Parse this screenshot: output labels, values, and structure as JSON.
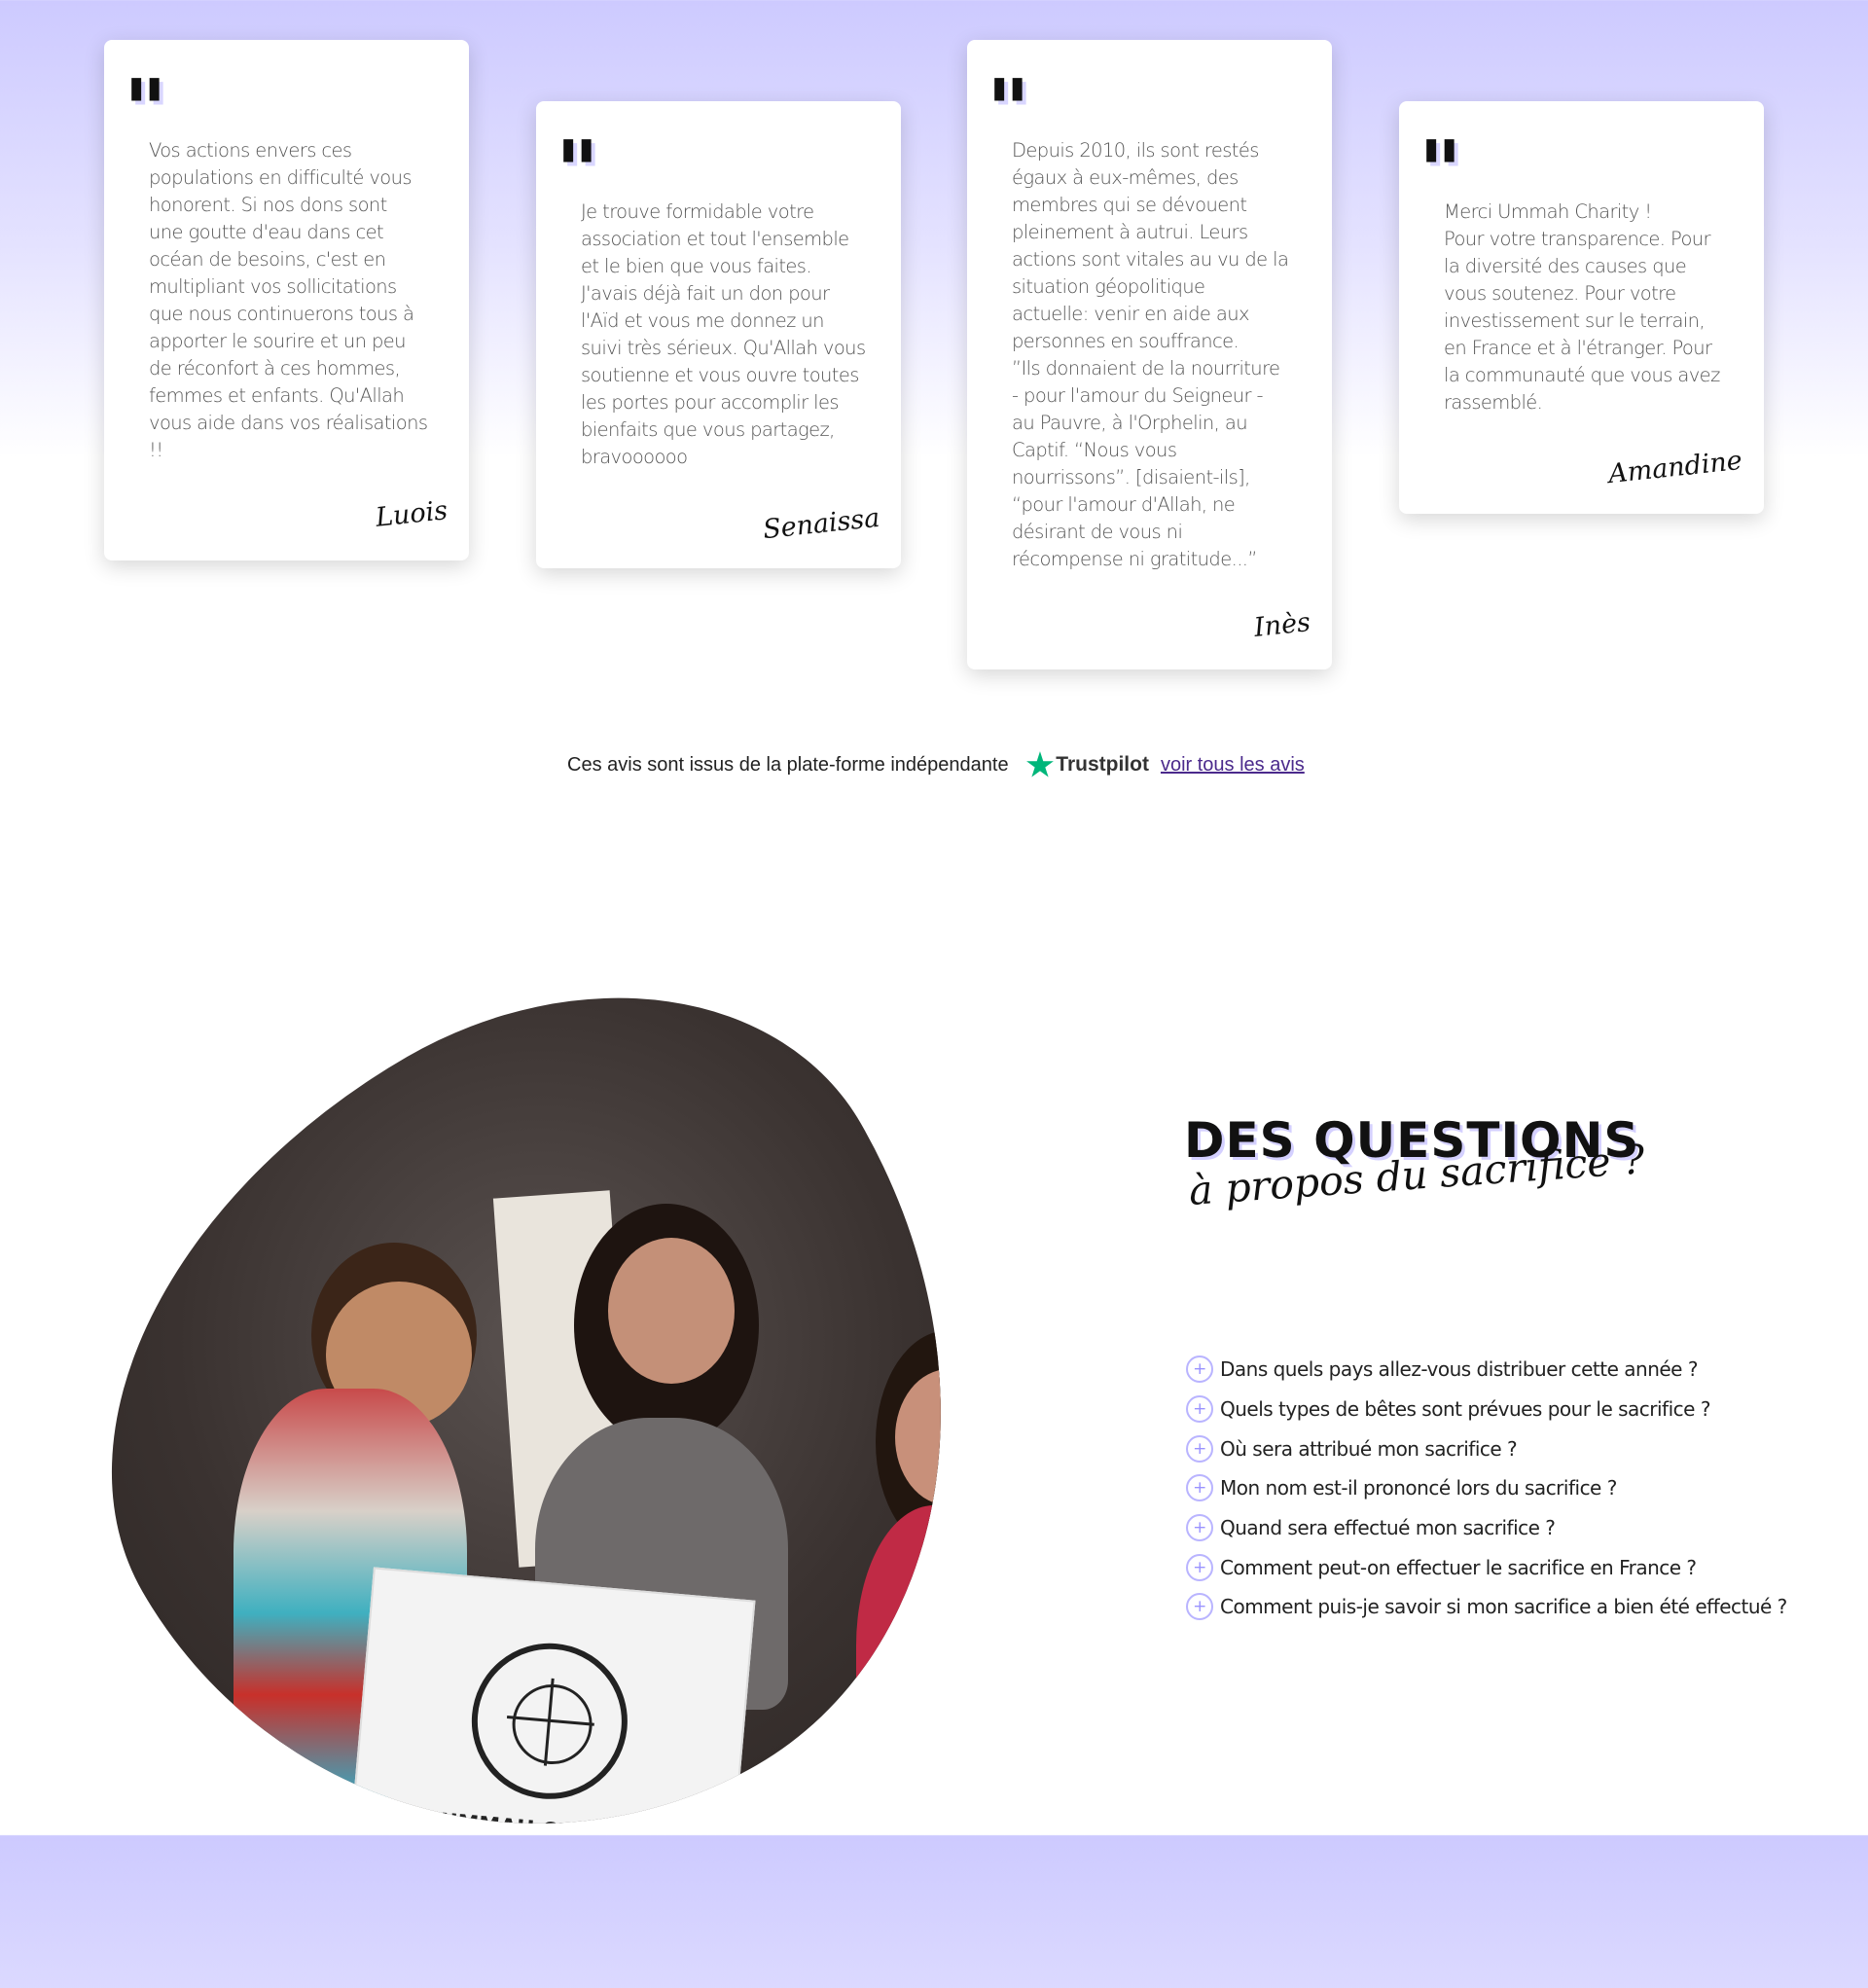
{
  "testimonials": [
    {
      "text": "Vos actions envers ces\npopulations en difficulté vous\nhonorent. Si nos dons sont\nune goutte d'eau dans cet\nocéan de besoins, c'est en\nmultipliant vos sollicitations\nque nous continuerons tous à\napporter le sourire et un peu\nde réconfort à ces hommes,\nfemmes et enfants. Qu'Allah\nvous aide dans vos réalisations\n!!",
      "author": "Luois"
    },
    {
      "text": "Je trouve formidable votre\nassociation et tout l'ensemble\net le bien que vous faites.\nJ'avais déjà fait un don pour\nl'Aïd et vous me donnez un\nsuivi très sérieux. Qu'Allah vous\nsoutienne et vous ouvre toutes\nles portes pour accomplir les\nbienfaits que vous partagez,\nbravoooooo",
      "author": "Senaissa"
    },
    {
      "text": "Depuis 2010, ils sont restés\négaux à eux-mêmes, des\nmembres qui se dévouent\npleinement à autrui. Leurs\nactions sont vitales au vu de la\nsituation géopolitique\nactuelle: venir en aide aux\npersonnes en souffrance.\n”Ils donnaient de la nourriture\n- pour l'amour du Seigneur -\nau Pauvre, à l'Orphelin, au\nCaptif. “Nous vous\nnourrissons”. [disaient-ils],\n“pour l'amour d'Allah, ne\ndésirant de vous ni\nrécompense ni gratitude...”",
      "author": "Inès"
    },
    {
      "text": "Merci Ummah Charity !\nPour votre transparence. Pour\nla diversité des causes que\nvous soutenez. Pour votre\ninvestissement sur le terrain,\nen France et à l'étranger. Pour\nla communauté que vous avez\nrassemblé.",
      "author": "Amandine"
    }
  ],
  "quote_glyph": "\"",
  "trust": {
    "text": "Ces avis sont issus de la plate-forme indépendante",
    "brand": "Trustpilot",
    "star": "★",
    "link": "voir tous les avis",
    "star_color": "#00b67a"
  },
  "photo": {
    "box_logo_text": "UMMAH CHARITY"
  },
  "faq": {
    "title": "DES QUESTIONS",
    "subtitle": "à propos du sacrifice ?",
    "plus_icon": "+",
    "items": [
      "Dans quels pays allez-vous distribuer cette année ?",
      "Quels types de bêtes sont prévues pour le sacrifice ?",
      "Où sera attribué mon sacrifice ?",
      "Mon nom est-il prononcé lors du sacrifice ?",
      "Quand sera effectué mon sacrifice ?",
      "Comment peut-on effectuer le sacrifice en France ?",
      "Comment puis-je savoir si mon sacrifice a bien été effectué ?"
    ]
  },
  "colors": {
    "accent": "#b9b4ff",
    "bg_top": "#cdcaff",
    "link": "#4b2a8c"
  }
}
